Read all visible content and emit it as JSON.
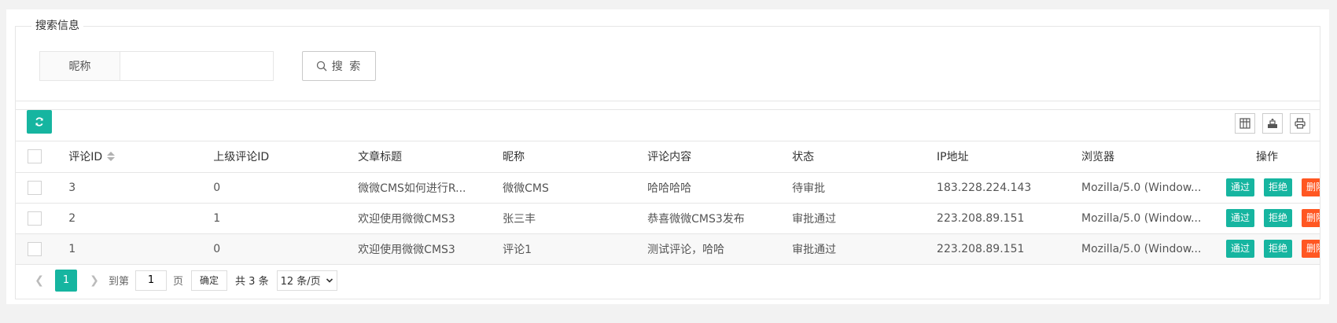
{
  "search": {
    "legend": "搜索信息",
    "field_label": "昵称",
    "input_value": "",
    "button_label": "搜 索"
  },
  "table": {
    "headers": [
      "评论ID",
      "上级评论ID",
      "文章标题",
      "昵称",
      "评论内容",
      "状态",
      "IP地址",
      "浏览器",
      "操作"
    ],
    "rows": [
      {
        "id": "3",
        "parent": "0",
        "title": "微微CMS如何进行R...",
        "nick": "微微CMS",
        "content": "哈哈哈哈",
        "status": "待审批",
        "ip": "183.228.224.143",
        "browser": "Mozilla/5.0 (Window..."
      },
      {
        "id": "2",
        "parent": "1",
        "title": "欢迎使用微微CMS3",
        "nick": "张三丰",
        "content": "恭喜微微CMS3发布",
        "status": "审批通过",
        "ip": "223.208.89.151",
        "browser": "Mozilla/5.0 (Window..."
      },
      {
        "id": "1",
        "parent": "0",
        "title": "欢迎使用微微CMS3",
        "nick": "评论1",
        "content": "测试评论，哈哈",
        "status": "审批通过",
        "ip": "223.208.89.151",
        "browser": "Mozilla/5.0 (Window..."
      }
    ],
    "actions": {
      "approve": "通过",
      "reject": "拒绝",
      "delete": "删除"
    }
  },
  "pager": {
    "current": "1",
    "goto_label": "到第",
    "goto_value": "1",
    "page_label": "页",
    "confirm_label": "确定",
    "total": "共 3 条",
    "page_size": "12 条/页"
  },
  "colors": {
    "accent": "#16b5a0",
    "danger": "#ff5722"
  },
  "icons": {
    "refresh": "refresh-icon",
    "search": "search-icon",
    "columns": "columns-icon",
    "export": "export-icon",
    "print": "print-icon"
  }
}
